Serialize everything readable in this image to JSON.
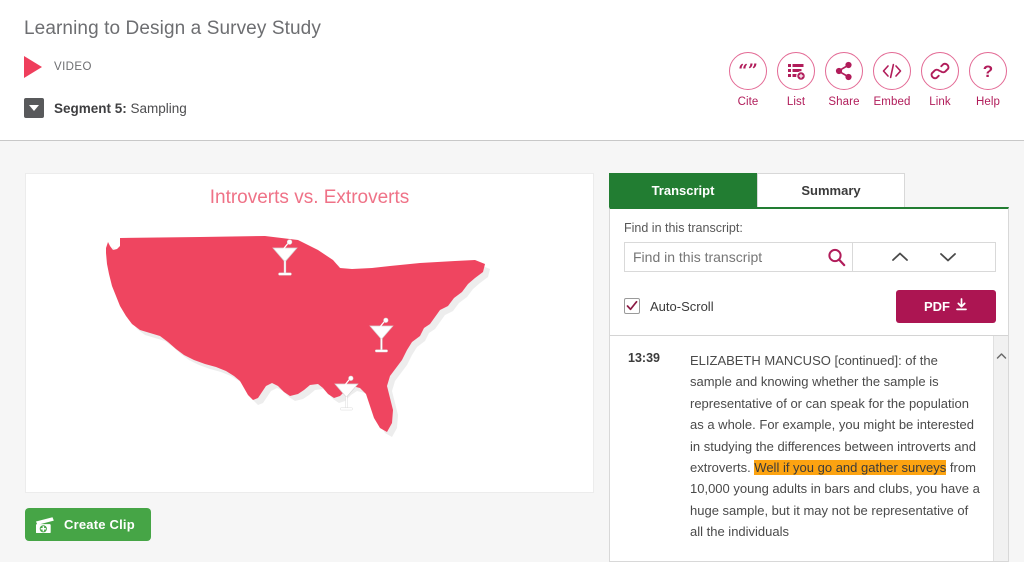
{
  "header": {
    "title": "Learning to Design a Survey Study",
    "media_type_label": "VIDEO",
    "segment_prefix": "Segment 5:",
    "segment_name": " Sampling",
    "toolbar": [
      {
        "icon": "quote-icon",
        "label": "Cite"
      },
      {
        "icon": "list-add-icon",
        "label": "List"
      },
      {
        "icon": "share-icon",
        "label": "Share"
      },
      {
        "icon": "code-icon",
        "label": "Embed"
      },
      {
        "icon": "link-icon",
        "label": "Link"
      },
      {
        "icon": "question-icon",
        "label": "Help"
      }
    ]
  },
  "video": {
    "slide_title": "Introverts vs. Extroverts",
    "map_region": "United States",
    "marker_icon": "cocktail-glass-icon",
    "marker_count": 3,
    "create_clip_label": "Create Clip"
  },
  "transcript": {
    "tabs": [
      {
        "label": "Transcript",
        "active": true
      },
      {
        "label": "Summary",
        "active": false
      }
    ],
    "find_label": "Find in this transcript:",
    "find_placeholder": "Find in this transcript",
    "find_value": "",
    "prev_icon": "chevron-up-icon",
    "next_icon": "chevron-down-icon",
    "autoscroll_label": "Auto-Scroll",
    "autoscroll_checked": true,
    "pdf_label": "PDF",
    "cue": {
      "timestamp": "13:39",
      "speaker": "ELIZABETH MANCUSO [continued]:",
      "text_before": "ELIZABETH MANCUSO [continued]: of the sample and knowing whether the sample is representative of or can speak for the population as a whole. For example, you might be interested in studying the differences between introverts and extroverts. ",
      "text_highlight": "Well if you go and gather surveys",
      "text_after": " from 10,000 young adults in bars and clubs, you have a huge sample, but it may not be representative of all the individuals"
    }
  },
  "colors": {
    "accent_pink": "#ef3e5c",
    "tool_magenta": "#b11c5a",
    "tab_green": "#227d32",
    "clip_green": "#46a546",
    "pdf_magenta": "#ac1552",
    "highlight_orange": "#fca311",
    "map_fill": "#ef4560"
  }
}
